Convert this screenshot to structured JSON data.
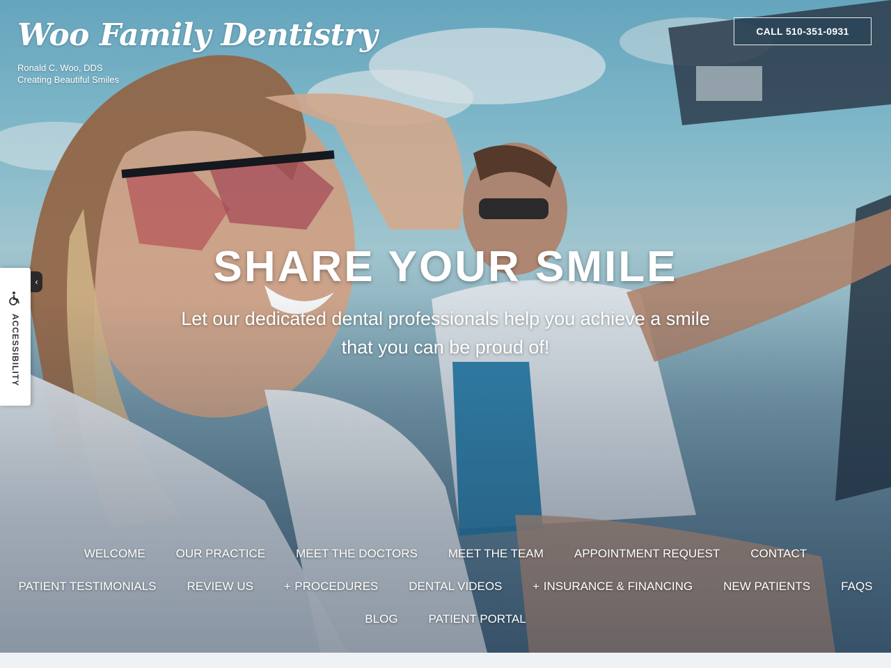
{
  "brand": {
    "name": "Woo Family Dentistry",
    "doctor": "Ronald C. Woo, DDS",
    "tagline": "Creating Beautiful Smiles"
  },
  "call_button": {
    "label": "CALL 510-351-0931"
  },
  "hero": {
    "headline": "SHARE YOUR SMILE",
    "subline_1": "Let our dedicated dental professionals help you achieve a smile",
    "subline_2": "that you can be proud of!"
  },
  "accessibility": {
    "label": "ACCESSIBILITY",
    "toggle_icon": "chevron-left-icon",
    "icon": "wheelchair-icon"
  },
  "nav": {
    "row1": [
      "WELCOME",
      "OUR PRACTICE",
      "MEET THE DOCTORS",
      "MEET THE TEAM",
      "APPOINTMENT REQUEST",
      "CONTACT"
    ],
    "row2": [
      "PATIENT TESTIMONIALS",
      "REVIEW US",
      "PROCEDURES",
      "DENTAL VIDEOS",
      "INSURANCE & FINANCING",
      "NEW PATIENTS",
      "FAQS"
    ],
    "row3": [
      "BLOG",
      "PATIENT PORTAL"
    ],
    "expand_symbol": "+"
  }
}
